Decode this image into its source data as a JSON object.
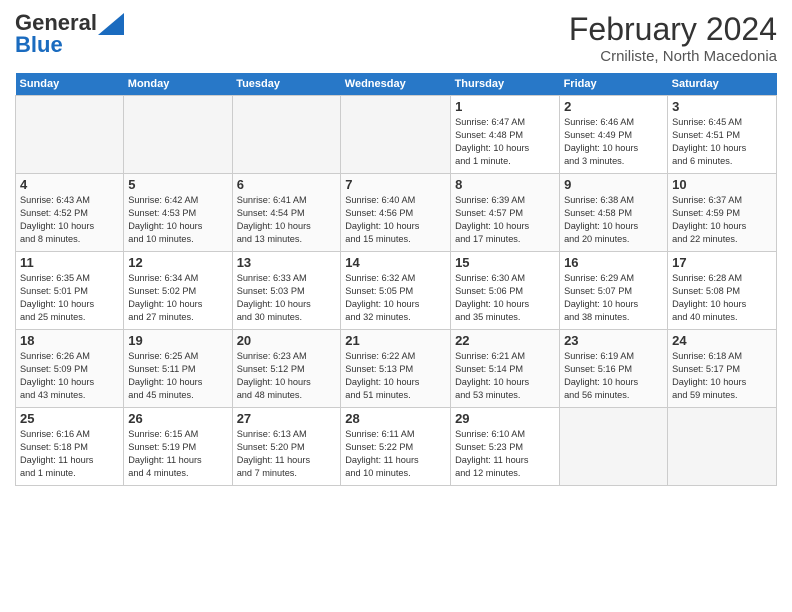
{
  "header": {
    "logo_line1": "General",
    "logo_line2": "Blue",
    "title": "February 2024",
    "subtitle": "Crniliste, North Macedonia"
  },
  "days_of_week": [
    "Sunday",
    "Monday",
    "Tuesday",
    "Wednesday",
    "Thursday",
    "Friday",
    "Saturday"
  ],
  "weeks": [
    [
      {
        "num": "",
        "detail": ""
      },
      {
        "num": "",
        "detail": ""
      },
      {
        "num": "",
        "detail": ""
      },
      {
        "num": "",
        "detail": ""
      },
      {
        "num": "1",
        "detail": "Sunrise: 6:47 AM\nSunset: 4:48 PM\nDaylight: 10 hours\nand 1 minute."
      },
      {
        "num": "2",
        "detail": "Sunrise: 6:46 AM\nSunset: 4:49 PM\nDaylight: 10 hours\nand 3 minutes."
      },
      {
        "num": "3",
        "detail": "Sunrise: 6:45 AM\nSunset: 4:51 PM\nDaylight: 10 hours\nand 6 minutes."
      }
    ],
    [
      {
        "num": "4",
        "detail": "Sunrise: 6:43 AM\nSunset: 4:52 PM\nDaylight: 10 hours\nand 8 minutes."
      },
      {
        "num": "5",
        "detail": "Sunrise: 6:42 AM\nSunset: 4:53 PM\nDaylight: 10 hours\nand 10 minutes."
      },
      {
        "num": "6",
        "detail": "Sunrise: 6:41 AM\nSunset: 4:54 PM\nDaylight: 10 hours\nand 13 minutes."
      },
      {
        "num": "7",
        "detail": "Sunrise: 6:40 AM\nSunset: 4:56 PM\nDaylight: 10 hours\nand 15 minutes."
      },
      {
        "num": "8",
        "detail": "Sunrise: 6:39 AM\nSunset: 4:57 PM\nDaylight: 10 hours\nand 17 minutes."
      },
      {
        "num": "9",
        "detail": "Sunrise: 6:38 AM\nSunset: 4:58 PM\nDaylight: 10 hours\nand 20 minutes."
      },
      {
        "num": "10",
        "detail": "Sunrise: 6:37 AM\nSunset: 4:59 PM\nDaylight: 10 hours\nand 22 minutes."
      }
    ],
    [
      {
        "num": "11",
        "detail": "Sunrise: 6:35 AM\nSunset: 5:01 PM\nDaylight: 10 hours\nand 25 minutes."
      },
      {
        "num": "12",
        "detail": "Sunrise: 6:34 AM\nSunset: 5:02 PM\nDaylight: 10 hours\nand 27 minutes."
      },
      {
        "num": "13",
        "detail": "Sunrise: 6:33 AM\nSunset: 5:03 PM\nDaylight: 10 hours\nand 30 minutes."
      },
      {
        "num": "14",
        "detail": "Sunrise: 6:32 AM\nSunset: 5:05 PM\nDaylight: 10 hours\nand 32 minutes."
      },
      {
        "num": "15",
        "detail": "Sunrise: 6:30 AM\nSunset: 5:06 PM\nDaylight: 10 hours\nand 35 minutes."
      },
      {
        "num": "16",
        "detail": "Sunrise: 6:29 AM\nSunset: 5:07 PM\nDaylight: 10 hours\nand 38 minutes."
      },
      {
        "num": "17",
        "detail": "Sunrise: 6:28 AM\nSunset: 5:08 PM\nDaylight: 10 hours\nand 40 minutes."
      }
    ],
    [
      {
        "num": "18",
        "detail": "Sunrise: 6:26 AM\nSunset: 5:09 PM\nDaylight: 10 hours\nand 43 minutes."
      },
      {
        "num": "19",
        "detail": "Sunrise: 6:25 AM\nSunset: 5:11 PM\nDaylight: 10 hours\nand 45 minutes."
      },
      {
        "num": "20",
        "detail": "Sunrise: 6:23 AM\nSunset: 5:12 PM\nDaylight: 10 hours\nand 48 minutes."
      },
      {
        "num": "21",
        "detail": "Sunrise: 6:22 AM\nSunset: 5:13 PM\nDaylight: 10 hours\nand 51 minutes."
      },
      {
        "num": "22",
        "detail": "Sunrise: 6:21 AM\nSunset: 5:14 PM\nDaylight: 10 hours\nand 53 minutes."
      },
      {
        "num": "23",
        "detail": "Sunrise: 6:19 AM\nSunset: 5:16 PM\nDaylight: 10 hours\nand 56 minutes."
      },
      {
        "num": "24",
        "detail": "Sunrise: 6:18 AM\nSunset: 5:17 PM\nDaylight: 10 hours\nand 59 minutes."
      }
    ],
    [
      {
        "num": "25",
        "detail": "Sunrise: 6:16 AM\nSunset: 5:18 PM\nDaylight: 11 hours\nand 1 minute."
      },
      {
        "num": "26",
        "detail": "Sunrise: 6:15 AM\nSunset: 5:19 PM\nDaylight: 11 hours\nand 4 minutes."
      },
      {
        "num": "27",
        "detail": "Sunrise: 6:13 AM\nSunset: 5:20 PM\nDaylight: 11 hours\nand 7 minutes."
      },
      {
        "num": "28",
        "detail": "Sunrise: 6:11 AM\nSunset: 5:22 PM\nDaylight: 11 hours\nand 10 minutes."
      },
      {
        "num": "29",
        "detail": "Sunrise: 6:10 AM\nSunset: 5:23 PM\nDaylight: 11 hours\nand 12 minutes."
      },
      {
        "num": "",
        "detail": ""
      },
      {
        "num": "",
        "detail": ""
      }
    ]
  ]
}
